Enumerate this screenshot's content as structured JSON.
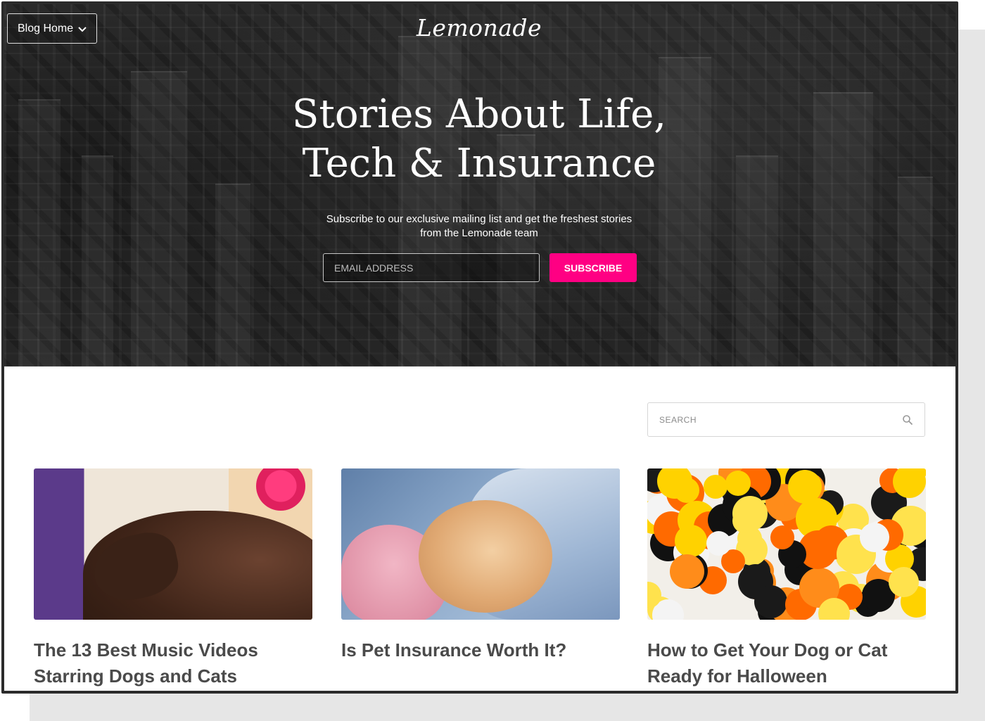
{
  "header": {
    "blog_home_label": "Blog Home",
    "logo_text": "Lemonade"
  },
  "hero": {
    "title_line1": "Stories About Life,",
    "title_line2": "Tech & Insurance",
    "subtitle_line1": "Subscribe to our exclusive mailing list and get the freshest stories",
    "subtitle_line2": "from the Lemonade team",
    "email_placeholder": "EMAIL ADDRESS",
    "subscribe_label": "SUBSCRIBE"
  },
  "search": {
    "placeholder": "SEARCH"
  },
  "posts": [
    {
      "title": "The 13 Best Music Videos Starring Dogs and Cats"
    },
    {
      "title": "Is Pet Insurance Worth It?"
    },
    {
      "title": "How to Get Your Dog or Cat Ready for Halloween"
    }
  ],
  "colors": {
    "accent": "#ff0083",
    "hero_bg": "#1f1f1f",
    "title_text": "#4a4a4a"
  },
  "icons": {
    "dropdown": "chevron-down-icon",
    "search": "search-icon"
  }
}
